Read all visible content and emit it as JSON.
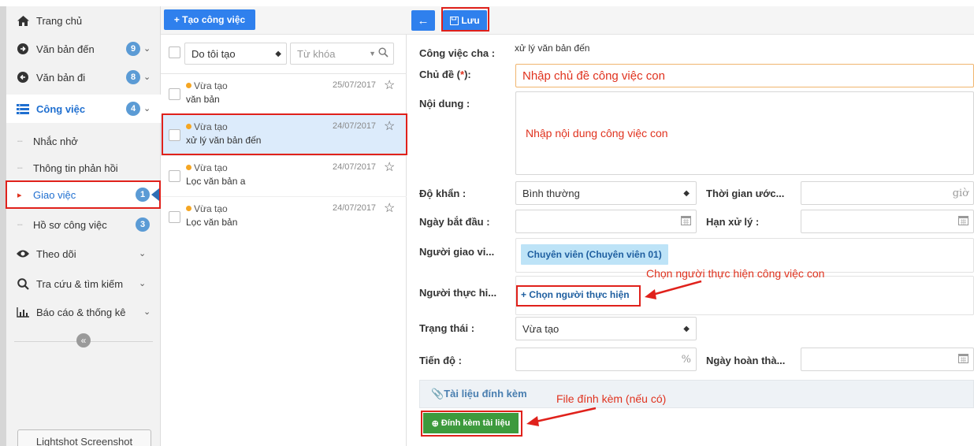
{
  "sidebar": {
    "items": [
      {
        "label": "Trang chủ",
        "icon": "home-icon"
      },
      {
        "label": "Văn bản đến",
        "badge": "9"
      },
      {
        "label": "Văn bản đi",
        "badge": "8"
      },
      {
        "label": "Công việc",
        "badge": "4"
      },
      {
        "label": "Theo dõi"
      },
      {
        "label": "Tra cứu & tìm kiếm"
      },
      {
        "label": "Báo cáo & thống kê"
      }
    ],
    "subitems": [
      {
        "label": "Nhắc nhở"
      },
      {
        "label": "Thông tin phản hồi"
      },
      {
        "label": "Giao việc",
        "badge": "1"
      },
      {
        "label": "Hồ sơ công việc",
        "badge": "3"
      }
    ],
    "collapse_glyph": "«",
    "lightshot_label": "Lightshot Screenshot"
  },
  "list": {
    "create_button": "+ Tạo công việc",
    "filter_value": "Do tôi tạo",
    "search_placeholder": "Từ khóa",
    "tasks": [
      {
        "status": "Vừa tạo",
        "date": "25/07/2017",
        "title": "văn bản"
      },
      {
        "status": "Vừa tạo",
        "date": "24/07/2017",
        "title": "xử lý văn bản đến"
      },
      {
        "status": "Vừa tạo",
        "date": "24/07/2017",
        "title": "Lọc văn bản a"
      },
      {
        "status": "Vừa tạo",
        "date": "24/07/2017",
        "title": "Lọc văn bản"
      }
    ]
  },
  "form": {
    "back_glyph": "←",
    "save_label": "Lưu",
    "parent_label": "Công việc cha :",
    "parent_value": "xử lý văn bản đến",
    "subject_label_pre": "Chủ đề (",
    "subject_label_star": "*",
    "subject_label_post": "):",
    "subject_value": "Nhập chủ đề công việc con",
    "content_label": "Nội dung :",
    "content_value": "Nhập nội dung công việc con",
    "urgency_label": "Độ khẩn :",
    "urgency_value": "Bình thường",
    "estimate_label": "Thời gian ước...",
    "estimate_unit": "giờ",
    "start_label": "Ngày bắt đầu :",
    "deadline_label": "Hạn xử lý :",
    "assigner_label": "Người giao vi...",
    "assigner_value": "Chuyên viên (Chuyên viên 01)",
    "executor_label": "Người thực hi...",
    "executor_button": "+ Chọn người thực hiện",
    "status_label": "Trạng thái :",
    "status_value": "Vừa tạo",
    "progress_label": "Tiến độ :",
    "progress_unit": "%",
    "complete_label": "Ngày hoàn thà...",
    "attachments_label": "Tài liệu đính kèm",
    "attach_button": "Đính kèm tài liệu"
  },
  "annotations": {
    "executor_note": "Chọn người thực hiện công việc con",
    "attach_note": "File đính kèm (nếu có)"
  },
  "colors": {
    "accent": "#2f80ed",
    "annotation_red": "#e0211b",
    "attach_green": "#3d9a3d",
    "badge_blue": "#5b9bd5",
    "status_orange": "#f5a623"
  }
}
